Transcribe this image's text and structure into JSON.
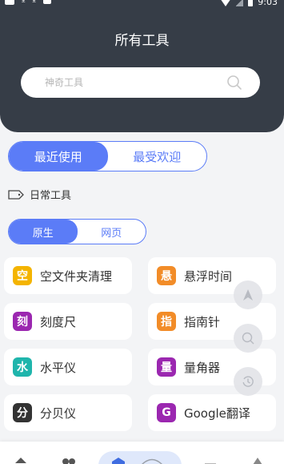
{
  "status": {
    "time": "9:03"
  },
  "header": {
    "title": "所有工具"
  },
  "search": {
    "placeholder": "神奇工具"
  },
  "tabs": [
    {
      "label": "最近使用",
      "active": true
    },
    {
      "label": "最受欢迎",
      "active": false
    }
  ],
  "category": {
    "label": "日常工具"
  },
  "subtabs": [
    {
      "label": "原生",
      "active": true
    },
    {
      "label": "网页",
      "active": false
    }
  ],
  "tools": [
    {
      "badge": "空",
      "label": "空文件夹清理",
      "color": "#f4b400"
    },
    {
      "badge": "悬",
      "label": "悬浮时间",
      "color": "#f28c28"
    },
    {
      "badge": "刻",
      "label": "刻度尺",
      "color": "#9b27b0"
    },
    {
      "badge": "指",
      "label": "指南针",
      "color": "#f28c28"
    },
    {
      "badge": "水",
      "label": "水平仪",
      "color": "#1fb5ac"
    },
    {
      "badge": "量",
      "label": "量角器",
      "color": "#9b27b0"
    },
    {
      "badge": "分",
      "label": "分贝仪",
      "color": "#333333"
    },
    {
      "badge": "G",
      "label": "Google翻译",
      "color": "#9b27b0"
    }
  ],
  "colors": {
    "accent": "#5b7cf7",
    "header": "#363d47"
  }
}
